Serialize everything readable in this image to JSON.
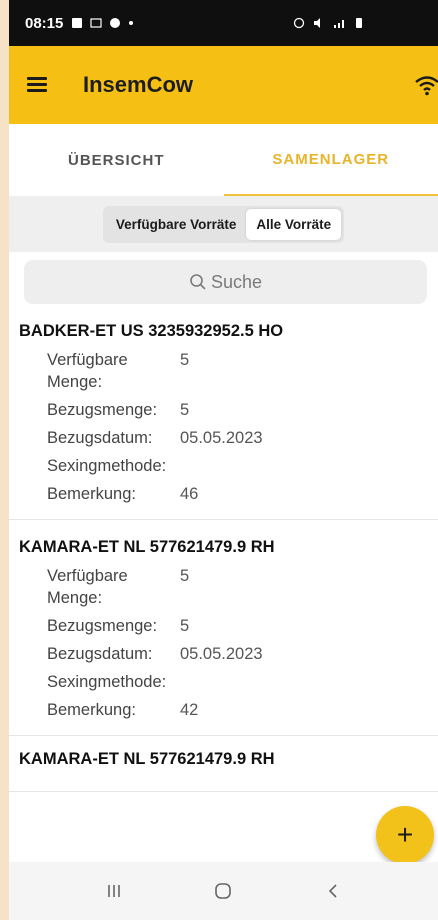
{
  "status_bar": {
    "time": "08:15"
  },
  "app_bar": {
    "title": "InsemCow"
  },
  "tabs": [
    {
      "label": "ÜBERSICHT",
      "active": false
    },
    {
      "label": "SAMENLAGER",
      "active": true
    }
  ],
  "filter": {
    "options": [
      "Verfügbare Vorräte",
      "Alle Vorräte"
    ],
    "selected": "Alle Vorräte"
  },
  "search": {
    "placeholder": "Suche"
  },
  "field_labels": {
    "available": "Verfügbare\nMenge:",
    "quantity": "Bezugsmenge:",
    "date": "Bezugsdatum:",
    "sexing": "Sexingmethode:",
    "remark": "Bemerkung:"
  },
  "items": [
    {
      "title": "BADKER-ET US 3235932952.5 HO",
      "available": "5",
      "quantity": "5",
      "date": "05.05.2023",
      "sexing": "",
      "remark": "46"
    },
    {
      "title": "KAMARA-ET NL 577621479.9 RH",
      "available": "5",
      "quantity": "5",
      "date": "05.05.2023",
      "sexing": "",
      "remark": "42"
    },
    {
      "title": "KAMARA-ET NL 577621479.9 RH"
    }
  ],
  "fab": {
    "label": "+"
  },
  "colors": {
    "accent": "#f5c013",
    "tab_active": "#e7b42a"
  }
}
